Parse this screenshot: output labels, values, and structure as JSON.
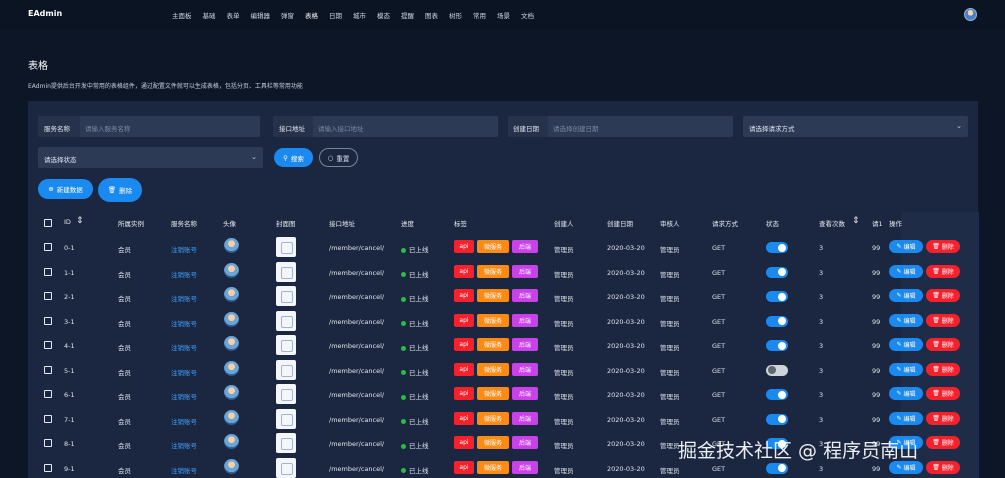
{
  "app": {
    "name": "EAdmin"
  },
  "nav": [
    "主面板",
    "基础",
    "表单",
    "编辑器",
    "弹窗",
    "表格",
    "日期",
    "城市",
    "模态",
    "提醒",
    "图表",
    "树形",
    "常用",
    "场景",
    "文档"
  ],
  "page": {
    "title": "表格",
    "description": "EAdmin提供后台开发中常用的表格组件，通过配置文件就可以生成表格，包括分页、工具栏等常用功能"
  },
  "filters": {
    "service_name": {
      "label": "服务名称",
      "placeholder": "请输入服务名称"
    },
    "api_address": {
      "label": "接口地址",
      "placeholder": "请输入接口地址"
    },
    "created_date": {
      "label": "创建日期",
      "placeholder": "请选择创建日期"
    },
    "request_method": {
      "value": "请选择请求方式"
    },
    "status": {
      "value": "请选择状态"
    },
    "search_label": "搜索",
    "reset_label": "重置"
  },
  "toolbar": {
    "add_label": "新建数据",
    "delete_label": "删除"
  },
  "table": {
    "headers": {
      "id": "ID",
      "instance": "所属实例",
      "service": "服务名称",
      "avatar": "头像",
      "cover": "封面图",
      "api": "接口地址",
      "progress": "进度",
      "tags": "标签",
      "creator": "创建人",
      "created": "创建日期",
      "reviewer": "审核人",
      "method": "请求方式",
      "state": "状态",
      "views": "查看次数",
      "extra": "请1",
      "actions": "操作"
    },
    "row_actions": {
      "edit": "编辑",
      "delete": "删除"
    },
    "tag_labels": [
      "api",
      "微服务",
      "后端"
    ],
    "tag_colors": [
      "#f5222d",
      "#fa8c16",
      "#c941e8"
    ],
    "rows": [
      {
        "id": "0-1",
        "instance": "会员",
        "service": "注销账号",
        "api": "/member/cancel/",
        "progress": "已上线",
        "creator": "管理员",
        "created": "2020-03-20",
        "reviewer": "管理员",
        "method": "GET",
        "enabled": true,
        "views": "3",
        "extra": "99"
      },
      {
        "id": "1-1",
        "instance": "会员",
        "service": "注销账号",
        "api": "/member/cancel/",
        "progress": "已上线",
        "creator": "管理员",
        "created": "2020-03-20",
        "reviewer": "管理员",
        "method": "GET",
        "enabled": true,
        "views": "3",
        "extra": "99"
      },
      {
        "id": "2-1",
        "instance": "会员",
        "service": "注销账号",
        "api": "/member/cancel/",
        "progress": "已上线",
        "creator": "管理员",
        "created": "2020-03-20",
        "reviewer": "管理员",
        "method": "GET",
        "enabled": true,
        "views": "3",
        "extra": "99"
      },
      {
        "id": "3-1",
        "instance": "会员",
        "service": "注销账号",
        "api": "/member/cancel/",
        "progress": "已上线",
        "creator": "管理员",
        "created": "2020-03-20",
        "reviewer": "管理员",
        "method": "GET",
        "enabled": true,
        "views": "3",
        "extra": "99"
      },
      {
        "id": "4-1",
        "instance": "会员",
        "service": "注销账号",
        "api": "/member/cancel/",
        "progress": "已上线",
        "creator": "管理员",
        "created": "2020-03-20",
        "reviewer": "管理员",
        "method": "GET",
        "enabled": true,
        "views": "3",
        "extra": "99"
      },
      {
        "id": "5-1",
        "instance": "会员",
        "service": "注销账号",
        "api": "/member/cancel/",
        "progress": "已上线",
        "creator": "管理员",
        "created": "2020-03-20",
        "reviewer": "管理员",
        "method": "GET",
        "enabled": false,
        "views": "3",
        "extra": "99"
      },
      {
        "id": "6-1",
        "instance": "会员",
        "service": "注销账号",
        "api": "/member/cancel/",
        "progress": "已上线",
        "creator": "管理员",
        "created": "2020-03-20",
        "reviewer": "管理员",
        "method": "GET",
        "enabled": true,
        "views": "3",
        "extra": "99"
      },
      {
        "id": "7-1",
        "instance": "会员",
        "service": "注销账号",
        "api": "/member/cancel/",
        "progress": "已上线",
        "creator": "管理员",
        "created": "2020-03-20",
        "reviewer": "管理员",
        "method": "GET",
        "enabled": true,
        "views": "3",
        "extra": "99"
      },
      {
        "id": "8-1",
        "instance": "会员",
        "service": "注销账号",
        "api": "/member/cancel/",
        "progress": "已上线",
        "creator": "管理员",
        "created": "2020-03-20",
        "reviewer": "管理员",
        "method": "GET",
        "enabled": true,
        "views": "3",
        "extra": "99"
      },
      {
        "id": "9-1",
        "instance": "会员",
        "service": "注销账号",
        "api": "/member/cancel/",
        "progress": "已上线",
        "creator": "管理员",
        "created": "2020-03-20",
        "reviewer": "管理员",
        "method": "GET",
        "enabled": true,
        "views": "3",
        "extra": "99"
      }
    ]
  },
  "watermark": "掘金技术社区 @ 程序员南山",
  "colors": {
    "background": "#0d1627",
    "panel": "#1b2740",
    "primary": "#1b8af0",
    "danger": "#f5222d",
    "success": "#25c13a",
    "link": "#3ea0ff"
  },
  "icons": [
    "user-avatar-icon",
    "search-icon",
    "reset-icon",
    "plus-icon",
    "trash-icon",
    "sort-icon",
    "edit-icon",
    "delete-icon",
    "chevron-down-icon",
    "image-placeholder-icon"
  ]
}
